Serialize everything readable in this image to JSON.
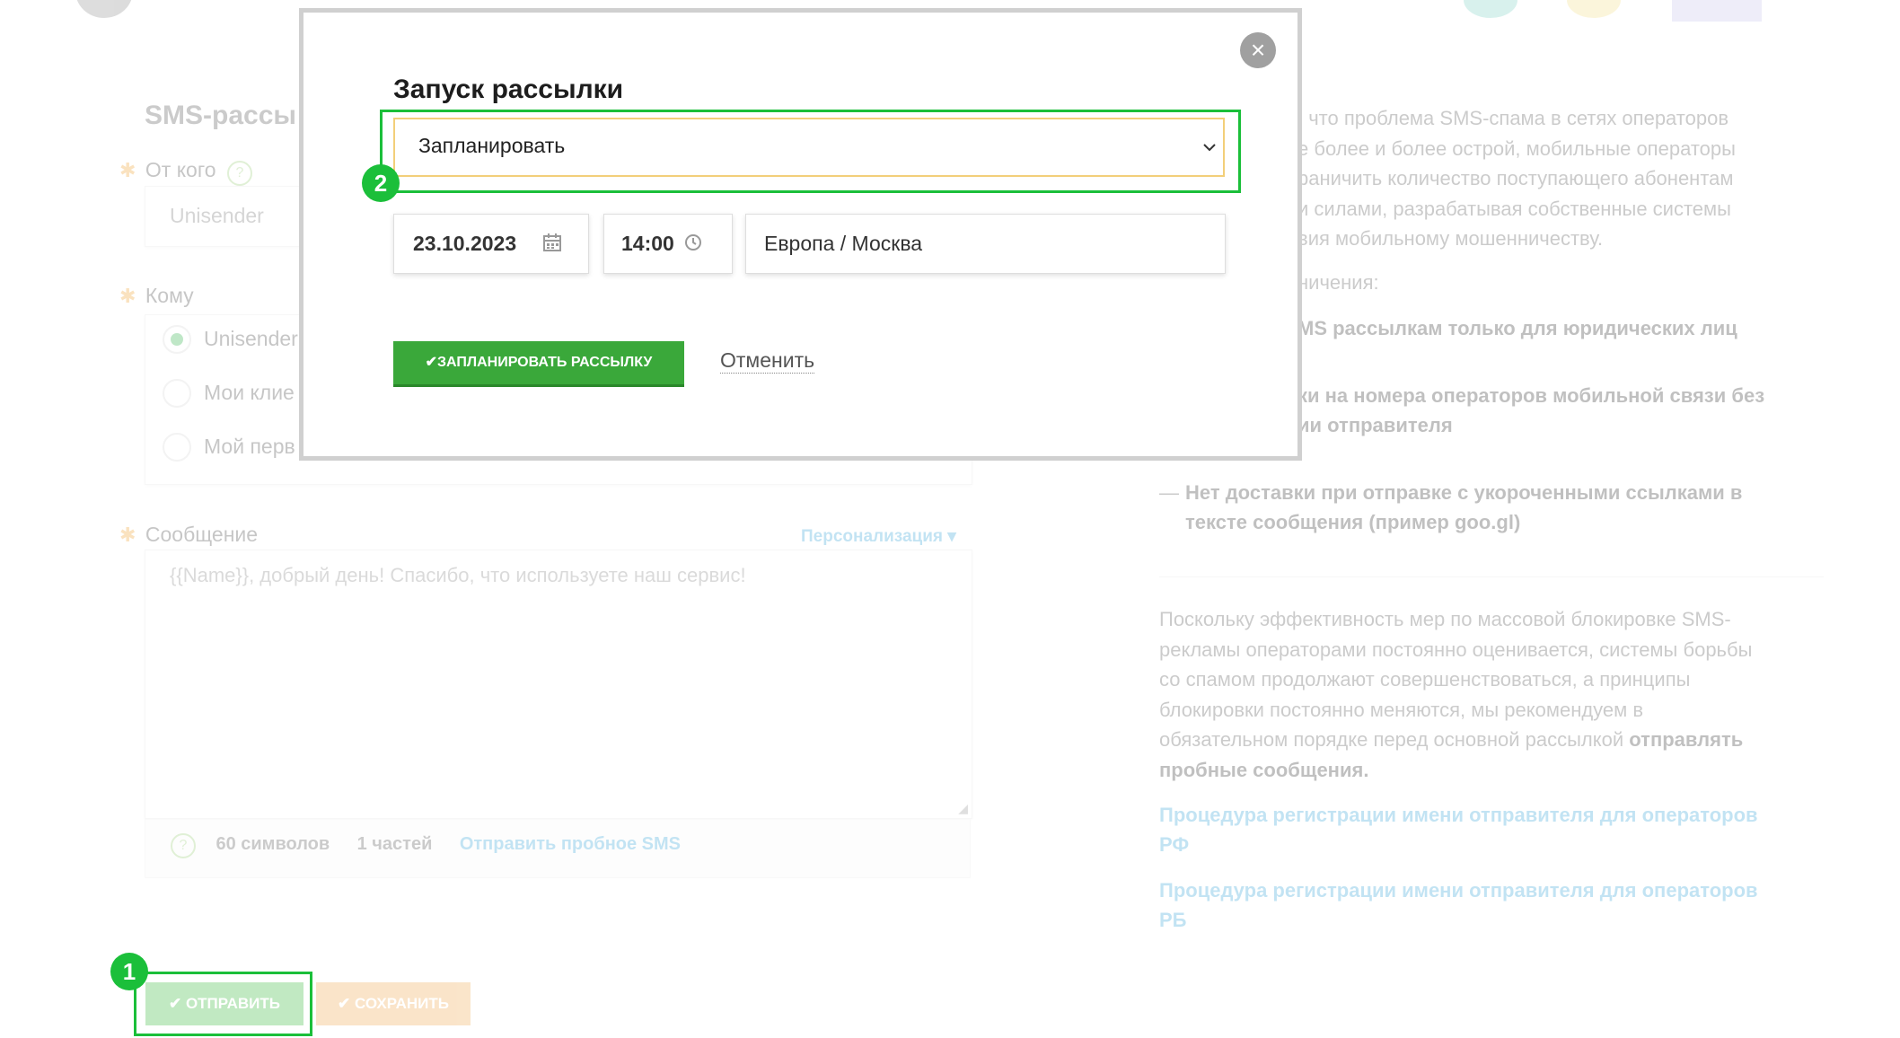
{
  "background": {
    "page_title": "SMS-рассы",
    "from": {
      "label": "От кого",
      "value": "Unisender"
    },
    "to": {
      "label": "Кому",
      "options": [
        {
          "label": "Unisender",
          "selected": true
        },
        {
          "label": "Мои клие",
          "selected": false
        },
        {
          "label": "Мой перв",
          "selected": false
        }
      ]
    },
    "message": {
      "label": "Сообщение",
      "personalization": "Персонализация",
      "placeholder": "{{Name}}, добрый день! Спасибо, что используете наш сервис!",
      "symbols": "60 символов",
      "parts": "1 частей",
      "test_link": "Отправить пробное SMS"
    },
    "buttons": {
      "send": "ОТПРАВИТЬ",
      "save": "СОХРАНИТЬ"
    },
    "right": {
      "intro_lines": [
        ", что проблема SMS-спама в сетях операторов",
        "е более и более острой, мобильные операторы",
        "раничить количество поступающего абонентам",
        "и силами, разрабатывая собственные системы",
        "вия мобильному мошенничеству."
      ],
      "restrictions": "ничения:",
      "b1": "MS рассылкам только для юридических лиц",
      "b2_l1": "ки на номера операторов мобильной связи без",
      "b2_l2": "ии отправителя",
      "b3_dash": "—",
      "b3_l1": "Нет доставки при отправке с укороченными ссылками в",
      "b3_l2": "тексте сообщения (пример goo.gl)",
      "para_lines": [
        "Поскольку эффективность мер по массовой блокировке SMS-",
        "рекламы операторами постоянно оценивается, системы борьбы",
        "со спамом продолжают совершенствоваться, а принципы",
        "блокировки постоянно меняются, мы рекомендуем в"
      ],
      "para_l5_normal": "обязательном порядке перед основной рассылкой ",
      "para_l5_bold": "отправлять",
      "para_l6_bold": "пробные сообщения.",
      "link1_l1": "Процедура регистрации имени отправителя для операторов",
      "link1_l2": "РФ",
      "link2_l1": "Процедура регистрации имени отправителя для операторов",
      "link2_l2": "РБ"
    }
  },
  "modal": {
    "title": "Запуск рассылки",
    "mode": "Запланировать",
    "date": "23.10.2023",
    "time": "14:00",
    "timezone": "Европа / Москва",
    "submit": "ЗАПЛАНИРОВАТЬ РАССЫЛКУ",
    "cancel": "Отменить"
  },
  "annotations": {
    "step1": "1",
    "step2": "2"
  },
  "colors": {
    "highlight": "#1bbf3a",
    "primary_button": "#3aa83a",
    "link": "#39a6d8"
  }
}
